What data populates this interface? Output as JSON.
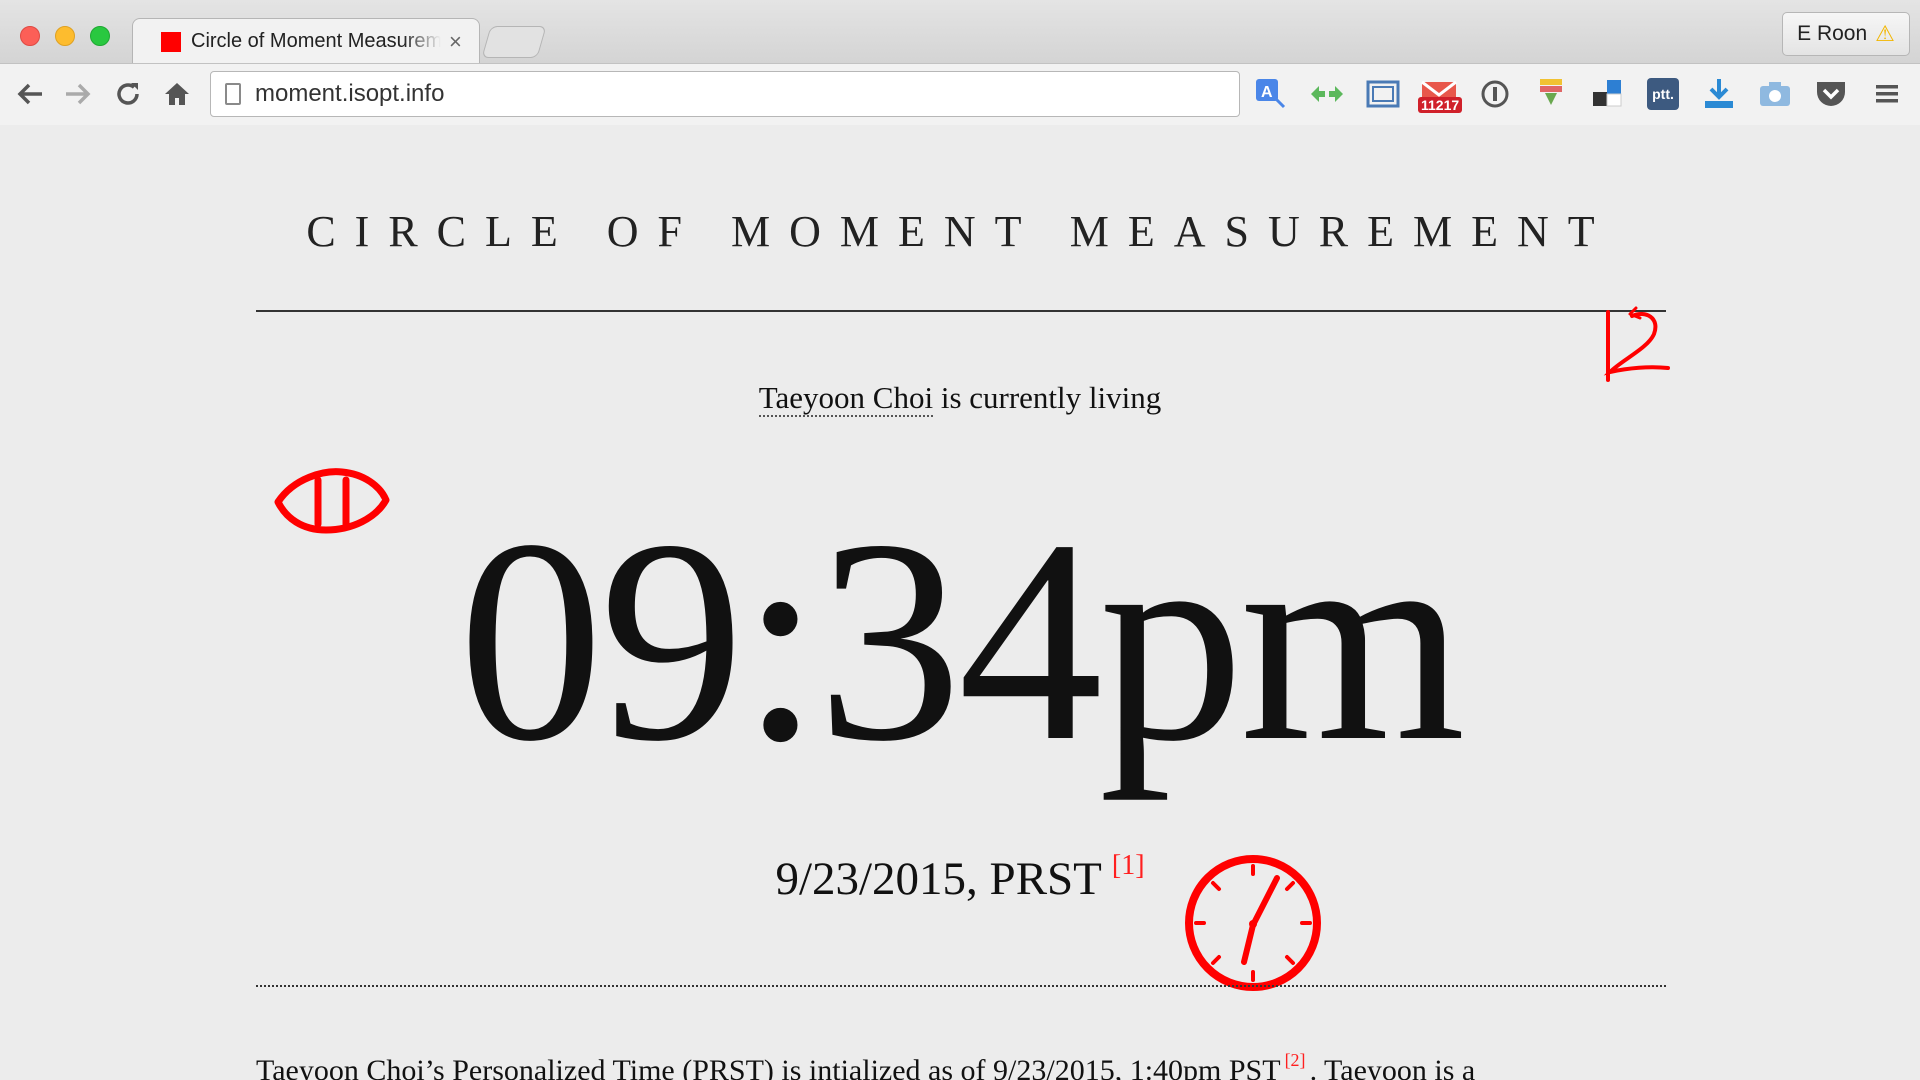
{
  "browser": {
    "tab_title": "Circle of Moment Measurement",
    "tab_close": "×",
    "url": "moment.isopt.info",
    "profile_name": "E Roon",
    "profile_warning": "⚠",
    "gmail_count": "11217",
    "ptt_label": "ptt."
  },
  "page": {
    "title": "CIRCLE OF MOMENT MEASUREMENT",
    "intro_name": "Taeyoon Choi",
    "intro_rest": " is currently living",
    "time": "09:34pm",
    "date": "9/23/2015, PRST",
    "footnote_1": "[1]",
    "bottom_part1_name": "Taeyoon Choi",
    "bottom_part1_rest": "’s Personalized Time (PRST) is intialized as of 9/23/2015, 1:40pm PST",
    "footnote_2": "[2]",
    "bottom_part2": ". Taeyoon is a"
  },
  "colors": {
    "accent_red": "#ff0000",
    "footnote_red": "#ff1f1f"
  }
}
